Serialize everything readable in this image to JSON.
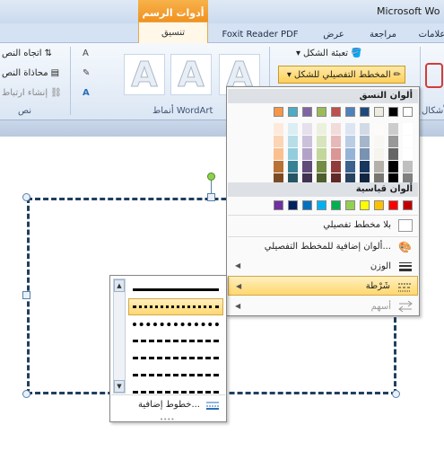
{
  "titlebar": {
    "app_title": "Microsoft Wo",
    "contextual_tab": "أدوات الرسم"
  },
  "tabs": [
    {
      "label": "علامات"
    },
    {
      "label": "عرض"
    },
    {
      "label": "مراجعة"
    },
    {
      "label": "Foxit Reader PDF"
    },
    {
      "label": "تنسيق"
    }
  ],
  "ribbon": {
    "shape_fill": "تعبئة الشكل",
    "shape_outline": "المخطط التفصيلي للشكل",
    "wordart_group": "أنماط WordArt",
    "text_group": "نص",
    "text_direction": "اتجاه النص",
    "align_text": "محاذاة النص",
    "create_link": "إنشاء ارتباط",
    "shapes_group": "الأشكال",
    "wordart_glyph": "A"
  },
  "menu": {
    "theme_colors": "ألوان النسق",
    "standard_colors": "ألوان قياسية",
    "no_outline": "بلا مخطط تفصيلي",
    "more_outline_colors": "ألوان إضافية للمخطط التفصيلي...",
    "weight": "الوزن",
    "dashes": "شَرْطة",
    "arrows": "أسهم",
    "theme_top_row": [
      "#ffffff",
      "#000000",
      "#eeece1",
      "#1f497d",
      "#4f81bd",
      "#c0504d",
      "#9bbb59",
      "#8064a2",
      "#4bacc6",
      "#f79646"
    ],
    "standard_row": [
      "#c00000",
      "#ff0000",
      "#ffc000",
      "#ffff00",
      "#92d050",
      "#00b050",
      "#00b0f0",
      "#0070c0",
      "#002060",
      "#7030a0"
    ]
  },
  "submenu": {
    "more_lines": "خطوط إضافية...",
    "scroll_up": "▲",
    "scroll_down": "▼",
    "dash_styles": [
      "solid",
      "round-dot",
      "square-dot",
      "dash",
      "dash-dot",
      "long-dash",
      "long-dash-dot"
    ]
  }
}
